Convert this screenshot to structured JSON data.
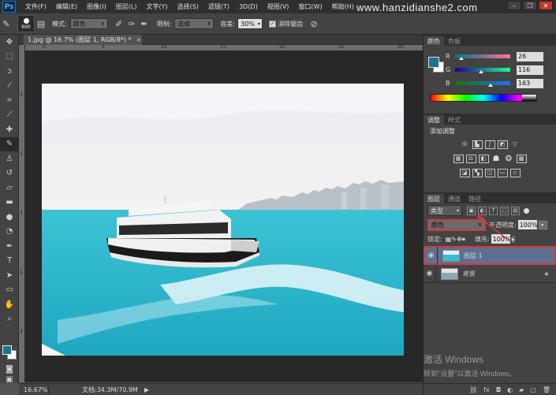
{
  "menubar": {
    "logo": "Ps",
    "items": [
      "文件(F)",
      "编辑(E)",
      "图像(I)",
      "图层(L)",
      "文字(Y)",
      "选择(S)",
      "滤镜(T)",
      "3D(D)",
      "视图(V)",
      "窗口(W)",
      "帮助(H)"
    ],
    "watermark": "www.hanzidianshe2.com"
  },
  "options": {
    "brush_size": "600",
    "mode_label": "模式:",
    "mode_value": "颜色",
    "limit_label": "限制:",
    "limit_value": "连续",
    "tolerance_label": "容差:",
    "tolerance_value": "30%",
    "antialias_label": "消除锯齿"
  },
  "document": {
    "tab_title": "1.jpg @ 16.7% (图层 1, RGB/8*) *",
    "ruler_h_ticks": [
      "0",
      "5",
      "10",
      "15",
      "20",
      "25",
      "30"
    ],
    "ruler_v_ticks": [
      "5",
      "1",
      "1",
      "1",
      "2"
    ]
  },
  "status": {
    "zoom": "16.67%",
    "doc_size": "文档:34.3M/70.9M"
  },
  "color_panel": {
    "tabs": [
      "颜色",
      "色板"
    ],
    "fg_color": "#1a748f",
    "r_label": "R",
    "r": "26",
    "g_label": "G",
    "g": "116",
    "b_label": "B",
    "b": "163"
  },
  "adjust_panel": {
    "tabs": [
      "调整",
      "样式"
    ],
    "title": "添加调整"
  },
  "layers_panel": {
    "tabs": [
      "图层",
      "通道",
      "路径"
    ],
    "kind_filter": "类型",
    "blend_mode": "颜色",
    "opacity_label": "不透明度:",
    "opacity": "100%",
    "lock_label": "锁定:",
    "fill_label": "填充:",
    "fill": "100%",
    "layers": [
      {
        "name": "图层 1",
        "selected": true
      },
      {
        "name": "背景",
        "selected": false,
        "locked": true
      }
    ]
  },
  "windows_notice": {
    "line1": "激活 Windows",
    "line2": "转到\"设置\"以激活 Windows。"
  }
}
